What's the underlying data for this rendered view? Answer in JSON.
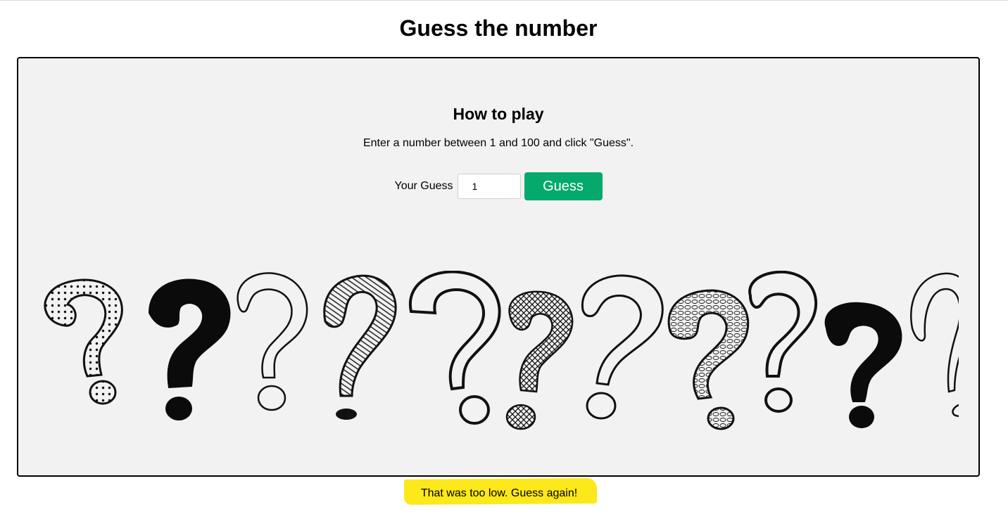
{
  "page": {
    "title": "Guess the number"
  },
  "panel": {
    "heading": "How to play",
    "instructions": "Enter a number between 1 and 100 and click \"Guess\".",
    "guess_label": "Your Guess",
    "guess_value": "1",
    "guess_button_label": "Guess",
    "illustration": "hand-drawn-question-marks"
  },
  "feedback": {
    "message": "That was too low. Guess again!",
    "highlight_color": "#fde81b"
  },
  "colors": {
    "button": "#06a96c",
    "panel_background": "#f2f2f2"
  }
}
